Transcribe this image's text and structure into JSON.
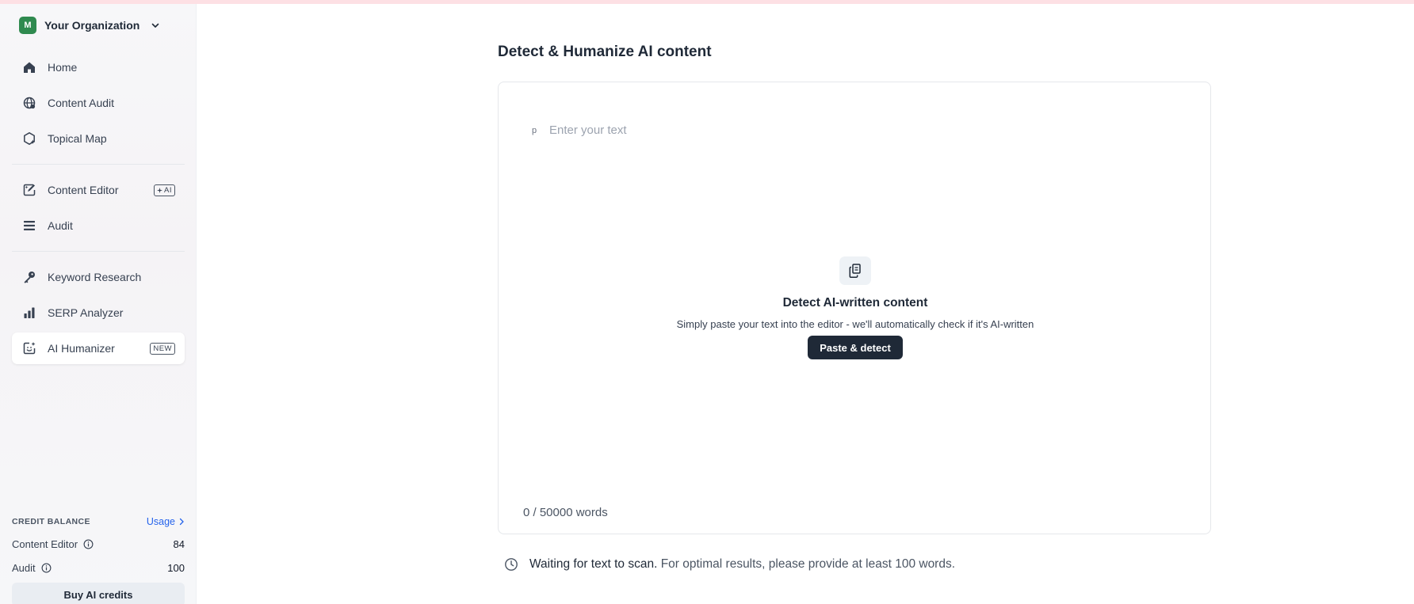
{
  "org": {
    "initial": "M",
    "name": "Your Organization",
    "avatar_color": "#2f8a4f"
  },
  "sidebar": {
    "items": [
      {
        "label": "Home",
        "icon": "home-icon"
      },
      {
        "label": "Content Audit",
        "icon": "globe-icon"
      },
      {
        "label": "Topical Map",
        "icon": "hexagon-sparkle-icon"
      },
      {
        "label": "Content Editor",
        "icon": "edit-sparkle-icon",
        "badge": "AI"
      },
      {
        "label": "Audit",
        "icon": "list-icon"
      },
      {
        "label": "Keyword Research",
        "icon": "key-icon"
      },
      {
        "label": "SERP Analyzer",
        "icon": "bar-chart-icon"
      },
      {
        "label": "AI Humanizer",
        "icon": "humanizer-icon",
        "badge": "NEW",
        "active": true
      }
    ]
  },
  "credits": {
    "title": "CREDIT BALANCE",
    "usage_label": "Usage",
    "rows": [
      {
        "label": "Content Editor",
        "value": "84"
      },
      {
        "label": "Audit",
        "value": "100"
      }
    ],
    "buy_label": "Buy AI credits"
  },
  "main": {
    "title": "Detect & Humanize AI content",
    "editor": {
      "para_marker": "p",
      "placeholder": "Enter your text",
      "empty_title": "Detect AI-written content",
      "empty_desc": "Simply paste your text into the editor - we'll automatically check if it's AI-written",
      "paste_label": "Paste & detect",
      "word_count": "0 / 50000 words"
    },
    "status": {
      "strong": "Waiting for text to scan.",
      "soft": "For optimal results, please provide at least 100 words."
    }
  },
  "colors": {
    "accent_dark": "#1f2937",
    "link": "#2563eb",
    "top_bar": "#fde0e4"
  }
}
